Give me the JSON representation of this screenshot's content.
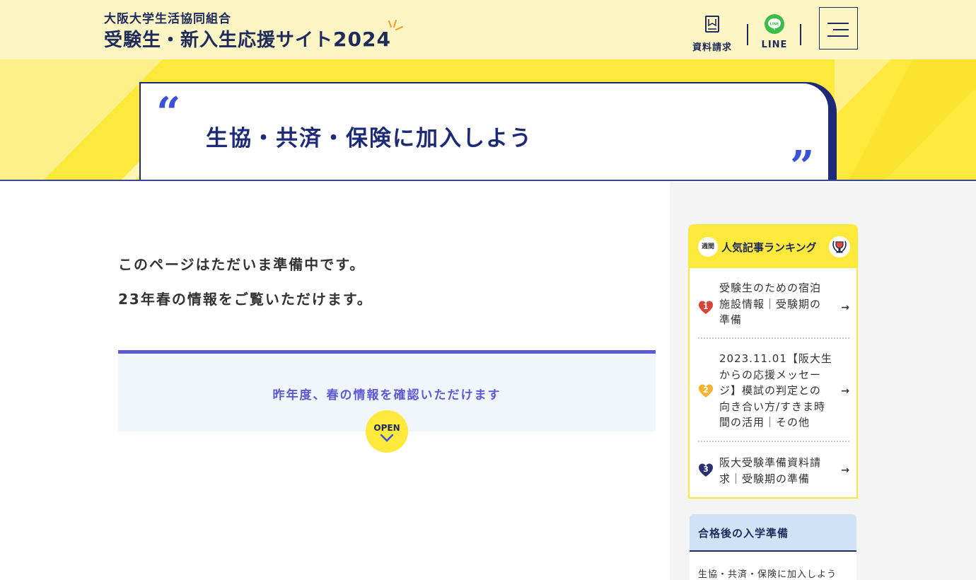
{
  "header": {
    "org_name": "大阪大学生活協同組合",
    "site_title": "受験生・新入生応援サイト",
    "site_year": "2024",
    "request_label": "資料請求",
    "line_label": "LINE"
  },
  "hero": {
    "quote_open": "“",
    "quote_close": "”",
    "title": "生協・共済・保険に加入しよう"
  },
  "main": {
    "notice_line1": "このページはただいま準備中です。",
    "notice_line2": "23年春の情報をご覧いただけます。",
    "accordion_title": "昨年度、春の情報を確認いただけます",
    "open_label": "OPEN"
  },
  "ranking": {
    "weekly_badge": "週間",
    "title": "人気記事ランキング",
    "items": [
      {
        "rank": "1",
        "title_lines": [
          "受験生のための宿泊",
          "施設情報｜受験期の",
          "準備"
        ],
        "color": "#d9443a"
      },
      {
        "rank": "2",
        "title_lines": [
          "2023.11.01【阪大生",
          "からの応援メッセー",
          "ジ】模試の判定との",
          "向き合い方/すきま時",
          "間の活用｜その他"
        ],
        "color": "#f5b533"
      },
      {
        "rank": "3",
        "title_lines": [
          "阪大受験準備資料請",
          "求｜受験期の準備"
        ],
        "color": "#2b3170"
      }
    ],
    "arrow": "→"
  },
  "category": {
    "title": "合格後の入学準備",
    "link": "生協・共済・保険に加入しよう"
  },
  "colors": {
    "navy": "#1f2a5c",
    "yellow": "#fde93c",
    "accent_blue": "#5b5bd8",
    "header_bg": "#fdf5c4"
  }
}
